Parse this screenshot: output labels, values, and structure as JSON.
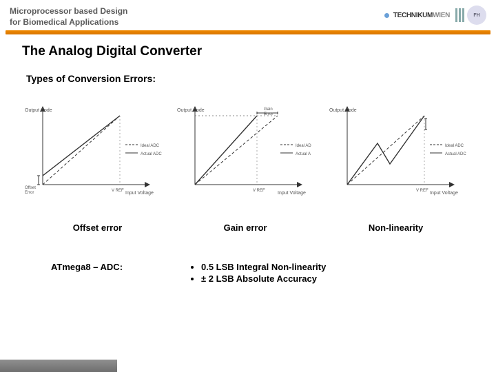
{
  "header": {
    "line1": "Microprocessor based Design",
    "line2": "for Biomedical Applications",
    "logo_text_a": "TECHNIKUM",
    "logo_text_b": "WIEN"
  },
  "title": "The Analog Digital Converter",
  "subtitle": "Types of Conversion Errors:",
  "captions": {
    "c1": "Offset error",
    "c2": "Gain error",
    "c3": "Non-linearity"
  },
  "axes": {
    "y": "Output Code",
    "x": "Input Voltage",
    "vref": "V REF"
  },
  "legend": {
    "ideal": "Ideal ADC",
    "actual": "Actual ADC",
    "ideal_short": "Ideal AD",
    "actual_short": "Actual A"
  },
  "annot": {
    "offset": "Offset Error",
    "gain": "Gain Error"
  },
  "atmega": "ATmega8 – ADC:",
  "specs": [
    "0.5 LSB Integral Non-linearity",
    "± 2 LSB Absolute Accuracy"
  ],
  "chart_data": [
    {
      "type": "line",
      "title": "Offset error",
      "xlabel": "Input Voltage",
      "ylabel": "Output Code",
      "xlim": [
        0,
        100
      ],
      "ylim": [
        0,
        100
      ],
      "series": [
        {
          "name": "Ideal ADC",
          "x": [
            0,
            100
          ],
          "y": [
            0,
            100
          ],
          "style": "dashed"
        },
        {
          "name": "Actual ADC",
          "x": [
            0,
            100
          ],
          "y": [
            12,
            100
          ],
          "style": "solid"
        }
      ],
      "annotations": [
        {
          "text": "Offset Error",
          "x": 5,
          "y": 6
        },
        {
          "text": "V REF",
          "x": 88,
          "y": 0
        }
      ]
    },
    {
      "type": "line",
      "title": "Gain error",
      "xlabel": "Input Voltage",
      "ylabel": "Output Code",
      "xlim": [
        0,
        100
      ],
      "ylim": [
        0,
        100
      ],
      "series": [
        {
          "name": "Ideal ADC",
          "x": [
            0,
            100
          ],
          "y": [
            0,
            100
          ],
          "style": "dashed"
        },
        {
          "name": "Actual ADC",
          "x": [
            0,
            80
          ],
          "y": [
            0,
            100
          ],
          "style": "solid"
        }
      ],
      "annotations": [
        {
          "text": "Gain Error",
          "x": 75,
          "y": 95
        },
        {
          "text": "V REF",
          "x": 78,
          "y": 0
        }
      ]
    },
    {
      "type": "line",
      "title": "Non-linearity",
      "xlabel": "Input Voltage",
      "ylabel": "Output Code",
      "xlim": [
        0,
        100
      ],
      "ylim": [
        0,
        100
      ],
      "series": [
        {
          "name": "Ideal ADC",
          "x": [
            0,
            100
          ],
          "y": [
            0,
            100
          ],
          "style": "dashed"
        },
        {
          "name": "Actual ADC",
          "x": [
            0,
            40,
            55,
            100
          ],
          "y": [
            0,
            55,
            30,
            100
          ],
          "style": "solid"
        }
      ],
      "annotations": [
        {
          "text": "V REF",
          "x": 88,
          "y": 0
        }
      ]
    }
  ]
}
